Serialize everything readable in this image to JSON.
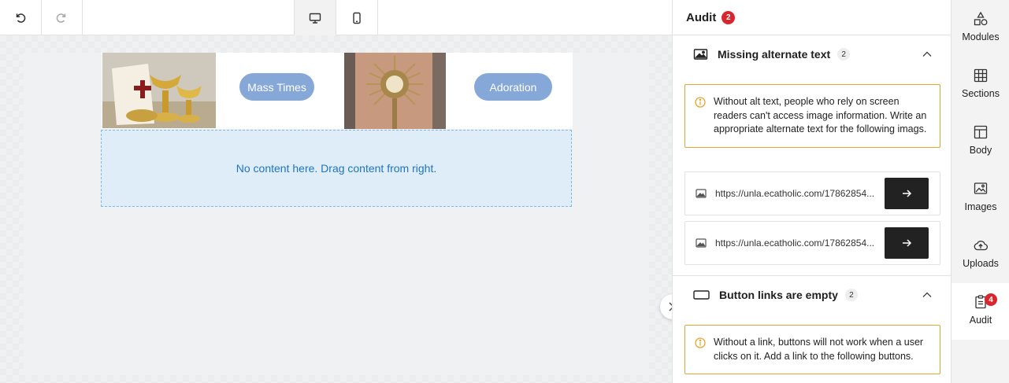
{
  "colors": {
    "accent_button": "#86a8d9",
    "badge_red": "#d8262e",
    "warning_border": "#e8a431",
    "dropzone_text": "#1f74c2"
  },
  "canvas": {
    "buttons": [
      "Mass Times",
      "Adoration"
    ],
    "dropzone_text": "No content here. Drag content from right."
  },
  "audit": {
    "title": "Audit",
    "count": "2",
    "missing_alt": {
      "label": "Missing alternate text",
      "count": "2",
      "warning": "Without alt text, people who rely on screen readers can't access image information. Write an appropriate alternate text for the following imags.",
      "urls": [
        "https://unla.ecatholic.com/17862854...",
        "https://unla.ecatholic.com/17862854..."
      ]
    },
    "empty_links": {
      "label": "Button links are empty",
      "count": "2",
      "warning": "Without a link, buttons will not work when a user clicks on it. Add a link to the following buttons."
    }
  },
  "rail": {
    "items": [
      {
        "label": "Modules",
        "icon": "modules-icon"
      },
      {
        "label": "Sections",
        "icon": "sections-icon"
      },
      {
        "label": "Body",
        "icon": "body-icon"
      },
      {
        "label": "Images",
        "icon": "images-icon"
      },
      {
        "label": "Uploads",
        "icon": "uploads-icon"
      },
      {
        "label": "Audit",
        "icon": "audit-icon",
        "badge": "4"
      }
    ]
  }
}
